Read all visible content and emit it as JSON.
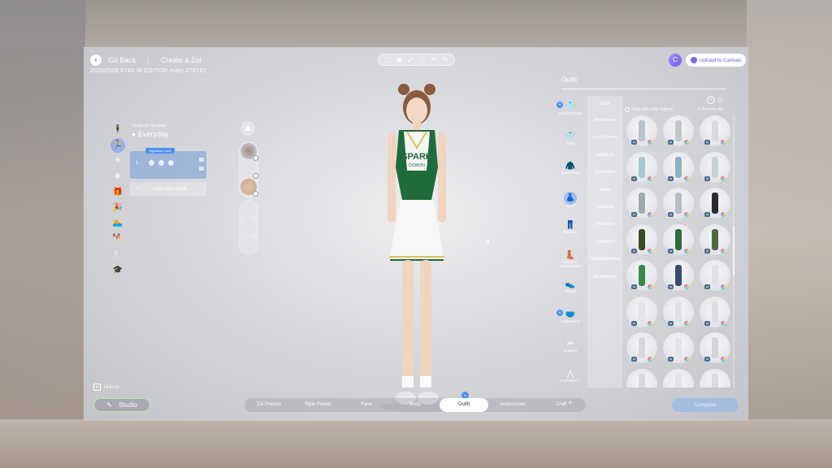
{
  "header": {
    "back_label": "Go Back",
    "separator": "|",
    "page_title": "Create a Zoi",
    "build_string": "20260508.6742.W.EDITOR.main.279762",
    "upload_label": "Upload to Canvas",
    "canvas_avatar_letter": "C"
  },
  "toolbar": {
    "icons": [
      "export-icon",
      "camera-icon",
      "fullscreen-icon",
      "screenshot-frame-icon",
      "undo-icon",
      "redo-icon"
    ],
    "glyphs": [
      "⬚",
      "◉",
      "⤢",
      "⛶",
      "↶",
      "↷"
    ]
  },
  "left_panel": {
    "occasion_label": "Looks by Occasion",
    "occasion_title": "Everyday",
    "occasion_arrow": "▸",
    "look_badge": "Signature Look",
    "look_number": "1",
    "add_look_plus": "+",
    "add_look_label": "Add New Look",
    "occasion_icons": [
      "person-icon",
      "runner-icon",
      "sun-icon",
      "snowflake-icon",
      "gift-icon",
      "party-icon",
      "swimmer-icon",
      "dog-icon",
      "moon-icon",
      "graduation-cap-icon"
    ],
    "occasion_glyphs": [
      "🕴",
      "🏃",
      "☀",
      "❄",
      "🎁",
      "🎉",
      "🏊",
      "🐕",
      "☾",
      "🎓"
    ],
    "active_occasion_index": 1
  },
  "outfit_panel": {
    "title": "Outfit",
    "categories": [
      {
        "label": "Outfit Presets",
        "glyph": "👕",
        "new": true
      },
      {
        "label": "Tops",
        "glyph": "👕",
        "new": false
      },
      {
        "label": "Outerwear",
        "glyph": "🧥",
        "new": false
      },
      {
        "label": "Sets",
        "glyph": "👗",
        "new": false
      },
      {
        "label": "Bottoms",
        "glyph": "👖",
        "new": false
      },
      {
        "label": "Fashion Accessories",
        "glyph": "👢",
        "new": false
      },
      {
        "label": "Shoes",
        "glyph": "👟",
        "new": false
      },
      {
        "label": "Underwear",
        "glyph": "🩲",
        "new": true
      },
      {
        "label": "Custom",
        "glyph": "✂",
        "new": false
      },
      {
        "label": "CONNECT",
        "glyph": "⋀",
        "new": false
      },
      {
        "label": "",
        "glyph": "✦",
        "new": false
      }
    ],
    "active_category_index": 3,
    "new_badge": "N",
    "sets_title": "Sets",
    "sets": [
      "Minidresses",
      "Long Dresses",
      "Jumpsuits",
      "Event Attire",
      "Styled",
      "Swimsuits",
      "Homewear",
      "CONNECT",
      "Contest Winners",
      "My Wardrobe"
    ],
    "color_option_label": "Only with color options",
    "remove_all_label": "Remove All",
    "filter_badge": "N",
    "tile_tag": "02",
    "tile_colors": [
      "#b8c4cc",
      "#c0c8cc",
      "#d6dade",
      "#a8c8d0",
      "#8fb0c4",
      "#c8d0d8",
      "#a0a8b0",
      "#b8bcc4",
      "#2c2c34",
      "#3a4a2a",
      "#2e6a3a",
      "#506a40",
      "#3a8a4a",
      "#3a4a6a",
      "#e0e2e6",
      "#e4e4e8",
      "#e0e0e4",
      "#dcdde0",
      "#d8d8dc",
      "#e4e4e8",
      "#d4d4d8",
      "#d8dadf",
      "#e2e2e6",
      "#dadade"
    ]
  },
  "bottom": {
    "hide_key": "U",
    "hide_label": "Hide UI",
    "studio_label": "Studio",
    "tabs": [
      "Zoi Presets",
      "Style Preset",
      "Face",
      "Body",
      "Outfit",
      "Accessories",
      "Craft"
    ],
    "active_tab_index": 4,
    "tab_new_badge": "N",
    "complete_label": "Complete"
  },
  "character": {
    "shirt_text_line1": "SPARK",
    "shirt_text_line2": "DOWON",
    "accent_green": "#1f6b3a",
    "accent_gold": "#d8c35a"
  }
}
